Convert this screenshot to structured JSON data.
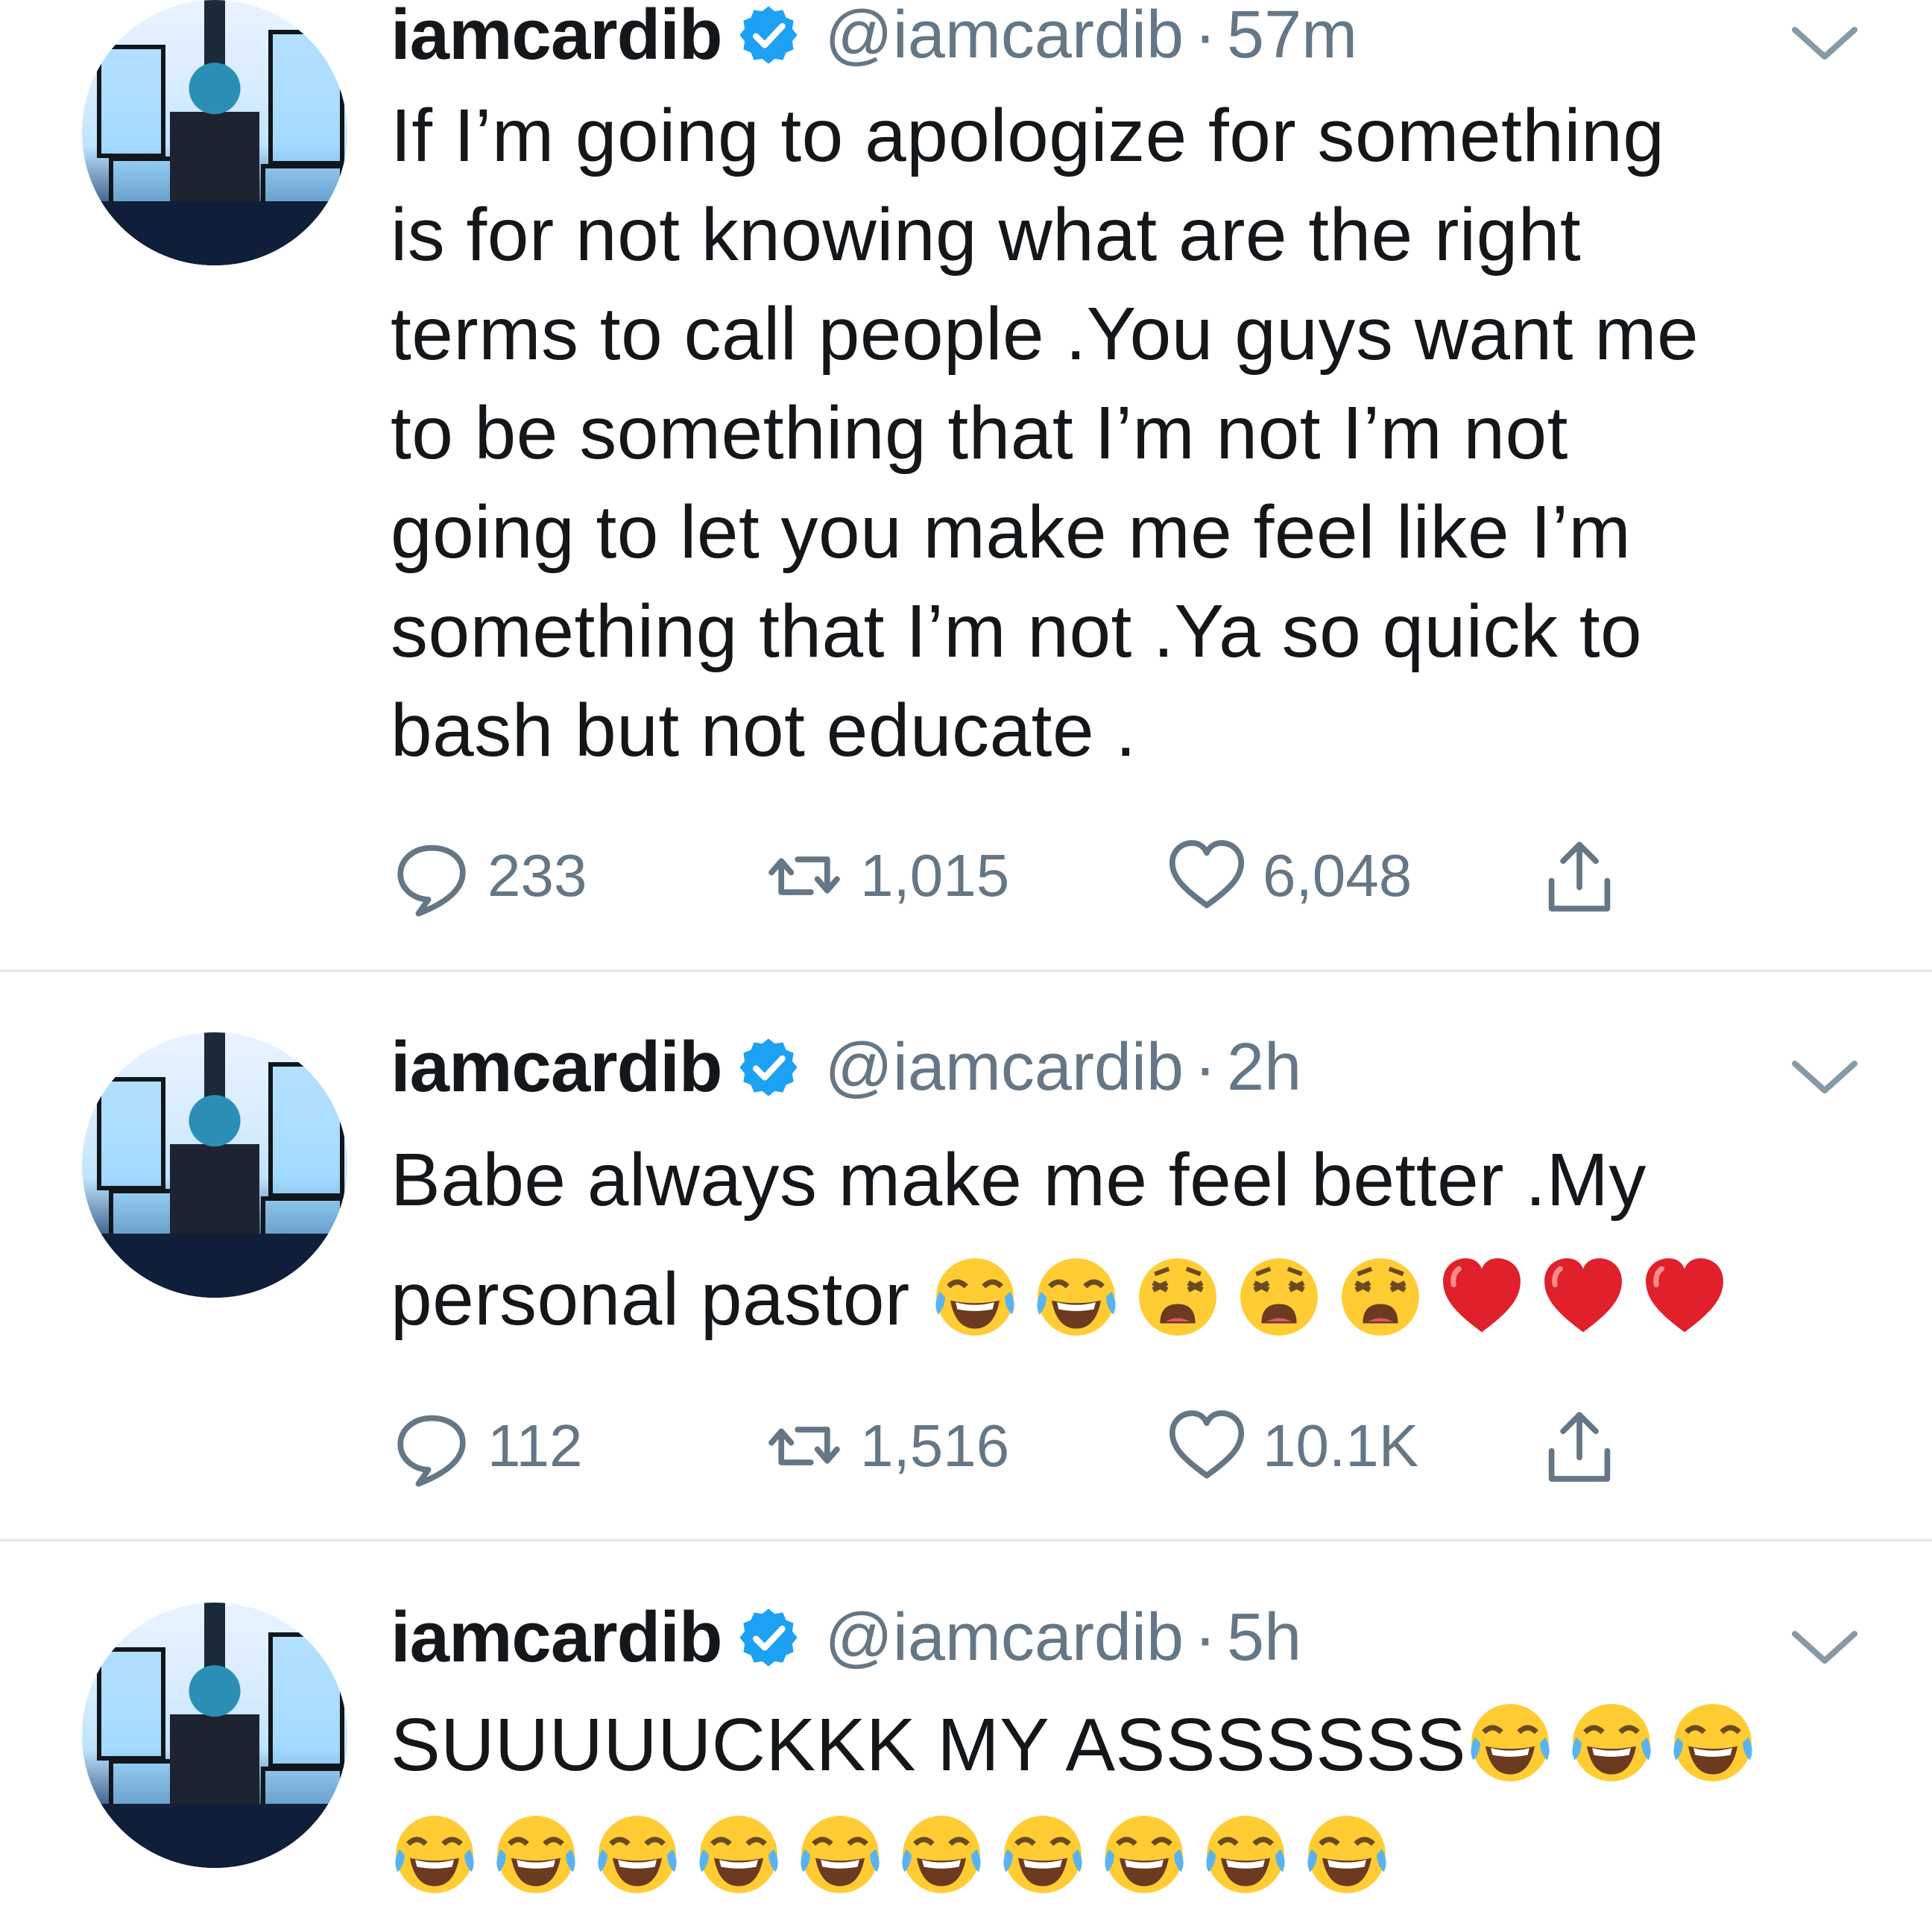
{
  "tweets": [
    {
      "name": "iamcardib",
      "handle": "@iamcardib",
      "separator": "·",
      "time": "57m",
      "lines": [
        "If I’m going to apologize for something",
        "is for not knowing what are the right",
        "terms to call people .You guys want me",
        "to be something that I’m not I’m not",
        "going to let you make me feel like I’m",
        "something that I’m not .Ya so quick to",
        "bash but not educate ."
      ],
      "replies": "233",
      "retweets": "1,015",
      "likes": "6,048"
    },
    {
      "name": "iamcardib",
      "handle": "@iamcardib",
      "separator": "·",
      "time": "2h",
      "lines": [
        "Babe always make me feel better .My",
        "personal pastor"
      ],
      "emoji_line2": [
        "joy-emoji",
        "joy-emoji",
        "weary-emoji",
        "weary-emoji",
        "weary-emoji",
        "red-heart-emoji",
        "red-heart-emoji",
        "red-heart-emoji"
      ],
      "replies": "112",
      "retweets": "1,516",
      "likes": "10.1K"
    },
    {
      "name": "iamcardib",
      "handle": "@iamcardib",
      "separator": "·",
      "time": "5h",
      "lines": [
        "SUUUUUCKKK MY ASSSSSSS"
      ],
      "emoji_line1": [
        "joy-emoji",
        "joy-emoji",
        "joy-emoji"
      ],
      "emoji_line2": [
        "joy-emoji",
        "joy-emoji",
        "joy-emoji",
        "joy-emoji",
        "joy-emoji",
        "joy-emoji",
        "joy-emoji",
        "joy-emoji",
        "joy-emoji",
        "joy-emoji"
      ]
    }
  ],
  "colors": {
    "text": "#14171a",
    "secondary": "#657786",
    "verified": "#1da1f2",
    "divider": "#e1e8ed"
  }
}
